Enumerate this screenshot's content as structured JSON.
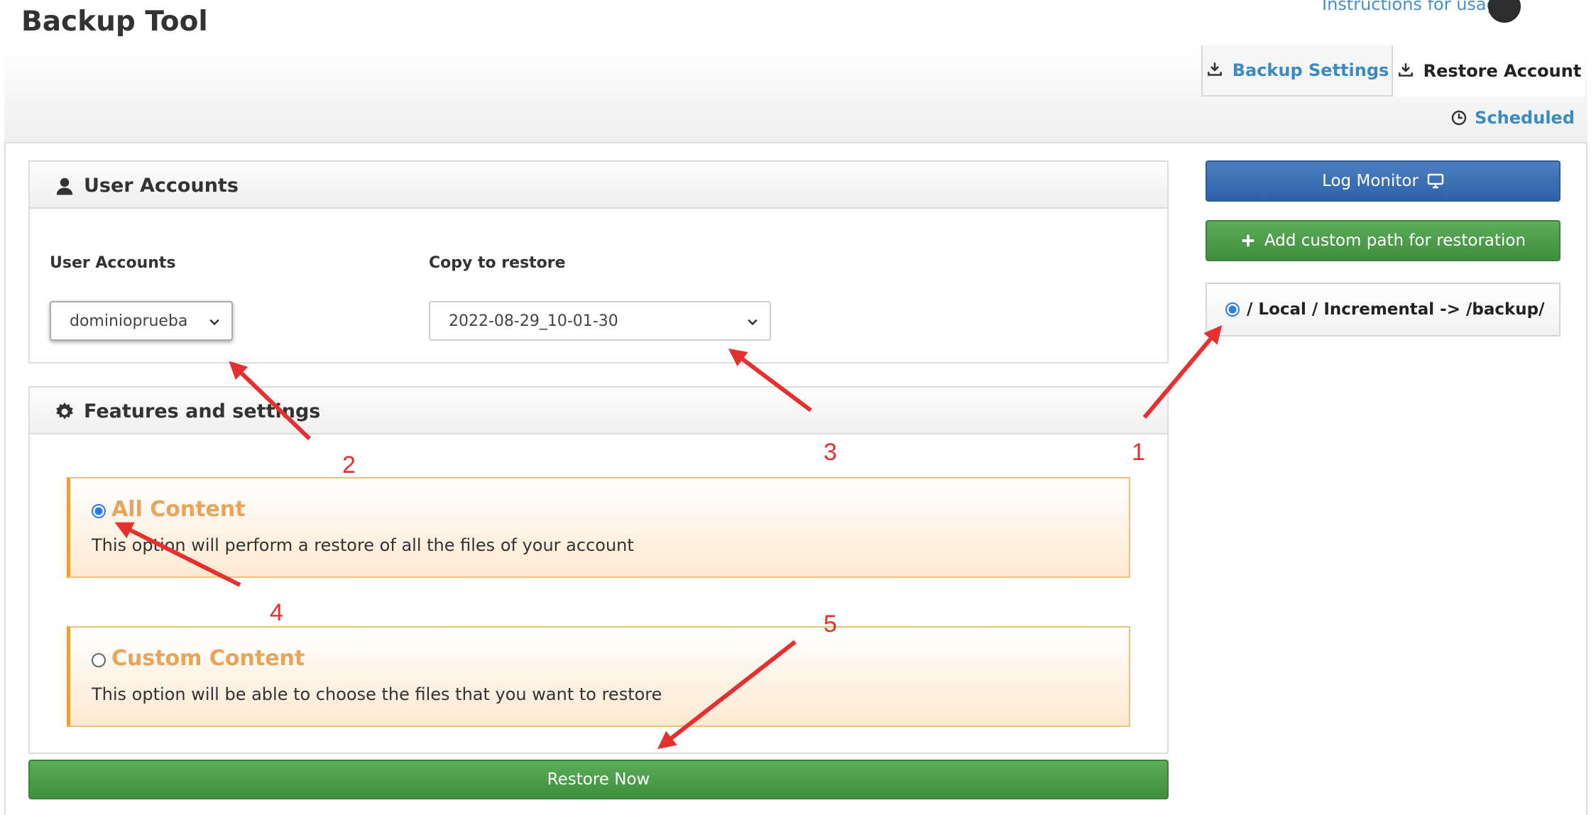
{
  "header": {
    "title": "Backup Tool",
    "help_link": "Instructions for usage"
  },
  "tabs": [
    {
      "label": "Backup Settings",
      "icon": "download-icon",
      "active": false
    },
    {
      "label": "Restore Account",
      "icon": "download-icon",
      "active": true
    }
  ],
  "scheduled": {
    "label": "Scheduled",
    "icon": "clock-icon"
  },
  "user_accounts_panel": {
    "title": "User Accounts",
    "icon": "user-icon",
    "user_field": {
      "label": "User Accounts",
      "value": "dominioprueba"
    },
    "copy_field": {
      "label": "Copy to restore",
      "value": "2022-08-29_10-01-30"
    }
  },
  "features_panel": {
    "title": "Features and settings",
    "icon": "gear-icon",
    "options": [
      {
        "title": "All Content",
        "description": "This option will perform a restore of all the files of your account",
        "selected": true
      },
      {
        "title": "Custom Content",
        "description": "This option will be able to choose the files that you want to restore",
        "selected": false
      }
    ]
  },
  "restore_button": {
    "label": "Restore Now"
  },
  "sidebar": {
    "log_monitor": {
      "label": "Log Monitor",
      "icon": "monitor-icon"
    },
    "add_path": {
      "label": "Add custom path for restoration",
      "icon": "plus-icon"
    },
    "path_option": {
      "label": "/ Local / Incremental -> /backup/",
      "selected": true
    }
  },
  "annotations": {
    "numbers": [
      "1",
      "2",
      "3",
      "4",
      "5"
    ],
    "color": "#e53030"
  },
  "colors": {
    "link_blue": "#3a8ac4",
    "primary_blue": "#2e62a8",
    "success_green": "#3e8e3e",
    "accent_orange": "#e8a55a"
  }
}
